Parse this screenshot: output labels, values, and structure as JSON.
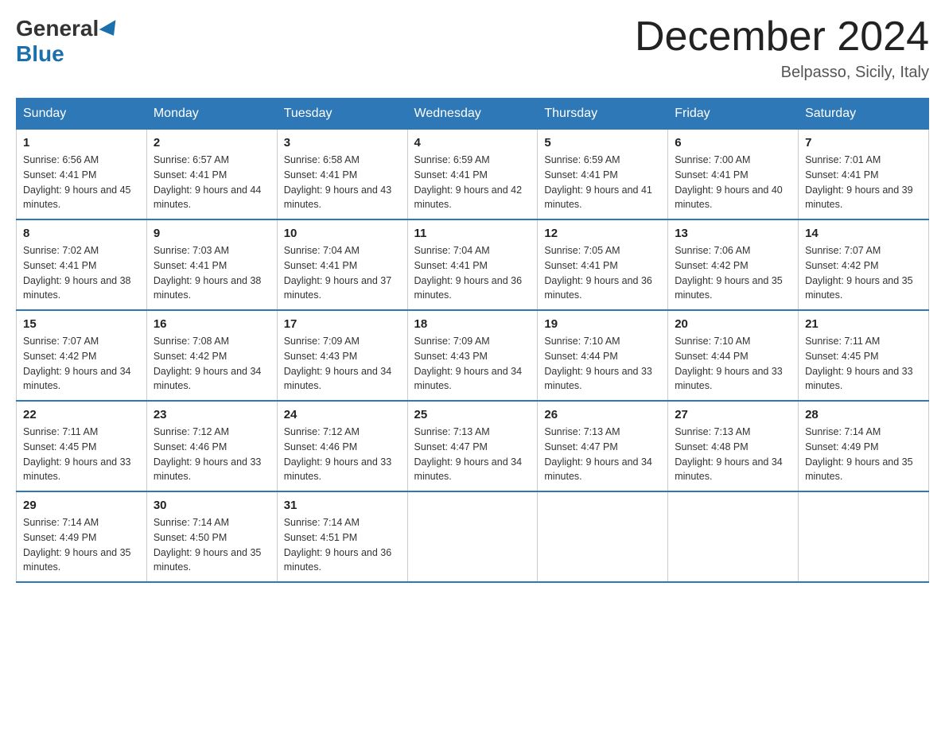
{
  "header": {
    "logo_general": "General",
    "logo_blue": "Blue",
    "month_title": "December 2024",
    "location": "Belpasso, Sicily, Italy"
  },
  "days_of_week": [
    "Sunday",
    "Monday",
    "Tuesday",
    "Wednesday",
    "Thursday",
    "Friday",
    "Saturday"
  ],
  "weeks": [
    [
      {
        "day": "1",
        "sunrise": "Sunrise: 6:56 AM",
        "sunset": "Sunset: 4:41 PM",
        "daylight": "Daylight: 9 hours and 45 minutes."
      },
      {
        "day": "2",
        "sunrise": "Sunrise: 6:57 AM",
        "sunset": "Sunset: 4:41 PM",
        "daylight": "Daylight: 9 hours and 44 minutes."
      },
      {
        "day": "3",
        "sunrise": "Sunrise: 6:58 AM",
        "sunset": "Sunset: 4:41 PM",
        "daylight": "Daylight: 9 hours and 43 minutes."
      },
      {
        "day": "4",
        "sunrise": "Sunrise: 6:59 AM",
        "sunset": "Sunset: 4:41 PM",
        "daylight": "Daylight: 9 hours and 42 minutes."
      },
      {
        "day": "5",
        "sunrise": "Sunrise: 6:59 AM",
        "sunset": "Sunset: 4:41 PM",
        "daylight": "Daylight: 9 hours and 41 minutes."
      },
      {
        "day": "6",
        "sunrise": "Sunrise: 7:00 AM",
        "sunset": "Sunset: 4:41 PM",
        "daylight": "Daylight: 9 hours and 40 minutes."
      },
      {
        "day": "7",
        "sunrise": "Sunrise: 7:01 AM",
        "sunset": "Sunset: 4:41 PM",
        "daylight": "Daylight: 9 hours and 39 minutes."
      }
    ],
    [
      {
        "day": "8",
        "sunrise": "Sunrise: 7:02 AM",
        "sunset": "Sunset: 4:41 PM",
        "daylight": "Daylight: 9 hours and 38 minutes."
      },
      {
        "day": "9",
        "sunrise": "Sunrise: 7:03 AM",
        "sunset": "Sunset: 4:41 PM",
        "daylight": "Daylight: 9 hours and 38 minutes."
      },
      {
        "day": "10",
        "sunrise": "Sunrise: 7:04 AM",
        "sunset": "Sunset: 4:41 PM",
        "daylight": "Daylight: 9 hours and 37 minutes."
      },
      {
        "day": "11",
        "sunrise": "Sunrise: 7:04 AM",
        "sunset": "Sunset: 4:41 PM",
        "daylight": "Daylight: 9 hours and 36 minutes."
      },
      {
        "day": "12",
        "sunrise": "Sunrise: 7:05 AM",
        "sunset": "Sunset: 4:41 PM",
        "daylight": "Daylight: 9 hours and 36 minutes."
      },
      {
        "day": "13",
        "sunrise": "Sunrise: 7:06 AM",
        "sunset": "Sunset: 4:42 PM",
        "daylight": "Daylight: 9 hours and 35 minutes."
      },
      {
        "day": "14",
        "sunrise": "Sunrise: 7:07 AM",
        "sunset": "Sunset: 4:42 PM",
        "daylight": "Daylight: 9 hours and 35 minutes."
      }
    ],
    [
      {
        "day": "15",
        "sunrise": "Sunrise: 7:07 AM",
        "sunset": "Sunset: 4:42 PM",
        "daylight": "Daylight: 9 hours and 34 minutes."
      },
      {
        "day": "16",
        "sunrise": "Sunrise: 7:08 AM",
        "sunset": "Sunset: 4:42 PM",
        "daylight": "Daylight: 9 hours and 34 minutes."
      },
      {
        "day": "17",
        "sunrise": "Sunrise: 7:09 AM",
        "sunset": "Sunset: 4:43 PM",
        "daylight": "Daylight: 9 hours and 34 minutes."
      },
      {
        "day": "18",
        "sunrise": "Sunrise: 7:09 AM",
        "sunset": "Sunset: 4:43 PM",
        "daylight": "Daylight: 9 hours and 34 minutes."
      },
      {
        "day": "19",
        "sunrise": "Sunrise: 7:10 AM",
        "sunset": "Sunset: 4:44 PM",
        "daylight": "Daylight: 9 hours and 33 minutes."
      },
      {
        "day": "20",
        "sunrise": "Sunrise: 7:10 AM",
        "sunset": "Sunset: 4:44 PM",
        "daylight": "Daylight: 9 hours and 33 minutes."
      },
      {
        "day": "21",
        "sunrise": "Sunrise: 7:11 AM",
        "sunset": "Sunset: 4:45 PM",
        "daylight": "Daylight: 9 hours and 33 minutes."
      }
    ],
    [
      {
        "day": "22",
        "sunrise": "Sunrise: 7:11 AM",
        "sunset": "Sunset: 4:45 PM",
        "daylight": "Daylight: 9 hours and 33 minutes."
      },
      {
        "day": "23",
        "sunrise": "Sunrise: 7:12 AM",
        "sunset": "Sunset: 4:46 PM",
        "daylight": "Daylight: 9 hours and 33 minutes."
      },
      {
        "day": "24",
        "sunrise": "Sunrise: 7:12 AM",
        "sunset": "Sunset: 4:46 PM",
        "daylight": "Daylight: 9 hours and 33 minutes."
      },
      {
        "day": "25",
        "sunrise": "Sunrise: 7:13 AM",
        "sunset": "Sunset: 4:47 PM",
        "daylight": "Daylight: 9 hours and 34 minutes."
      },
      {
        "day": "26",
        "sunrise": "Sunrise: 7:13 AM",
        "sunset": "Sunset: 4:47 PM",
        "daylight": "Daylight: 9 hours and 34 minutes."
      },
      {
        "day": "27",
        "sunrise": "Sunrise: 7:13 AM",
        "sunset": "Sunset: 4:48 PM",
        "daylight": "Daylight: 9 hours and 34 minutes."
      },
      {
        "day": "28",
        "sunrise": "Sunrise: 7:14 AM",
        "sunset": "Sunset: 4:49 PM",
        "daylight": "Daylight: 9 hours and 35 minutes."
      }
    ],
    [
      {
        "day": "29",
        "sunrise": "Sunrise: 7:14 AM",
        "sunset": "Sunset: 4:49 PM",
        "daylight": "Daylight: 9 hours and 35 minutes."
      },
      {
        "day": "30",
        "sunrise": "Sunrise: 7:14 AM",
        "sunset": "Sunset: 4:50 PM",
        "daylight": "Daylight: 9 hours and 35 minutes."
      },
      {
        "day": "31",
        "sunrise": "Sunrise: 7:14 AM",
        "sunset": "Sunset: 4:51 PM",
        "daylight": "Daylight: 9 hours and 36 minutes."
      },
      null,
      null,
      null,
      null
    ]
  ]
}
